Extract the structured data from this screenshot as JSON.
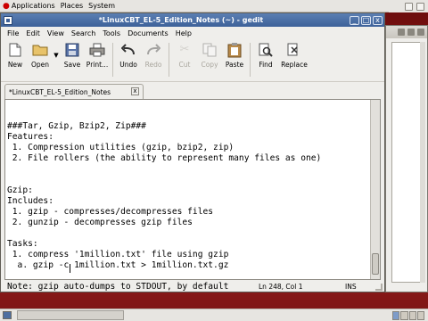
{
  "panel": {
    "menus": [
      "Applications",
      "Places",
      "System"
    ]
  },
  "window": {
    "title": "*LinuxCBT_EL-5_Edition_Notes (~) - gedit",
    "controls": [
      "_",
      "□",
      "x"
    ]
  },
  "menubar": [
    "File",
    "Edit",
    "View",
    "Search",
    "Tools",
    "Documents",
    "Help"
  ],
  "toolbar": {
    "new": "New",
    "open": "Open",
    "save": "Save",
    "print": "Print...",
    "undo": "Undo",
    "redo": "Redo",
    "cut": "Cut",
    "copy": "Copy",
    "paste": "Paste",
    "find": "Find",
    "replace": "Replace"
  },
  "tab": {
    "label": "*LinuxCBT_EL-5_Edition_Notes",
    "close": "x"
  },
  "editor": {
    "lines": [
      "###Tar, Gzip, Bzip2, Zip###",
      "Features:",
      " 1. Compression utilities (gzip, bzip2, zip)",
      " 2. File rollers (the ability to represent many files as one)",
      "",
      "",
      "Gzip:",
      "Includes:",
      " 1. gzip - compresses/decompresses files",
      " 2. gunzip - decompresses gzip files",
      "",
      "Tasks:",
      " 1. compress '1million.txt' file using gzip",
      "  a. gzip -c 1million.txt > 1million.txt.gz",
      "",
      "Note: gzip auto-dumps to STDOUT, by default"
    ]
  },
  "status": {
    "position": "Ln 248, Col 1",
    "mode": "INS"
  },
  "colors": {
    "titlebar": "#3d6199",
    "desktop": "#9a1f1f"
  }
}
